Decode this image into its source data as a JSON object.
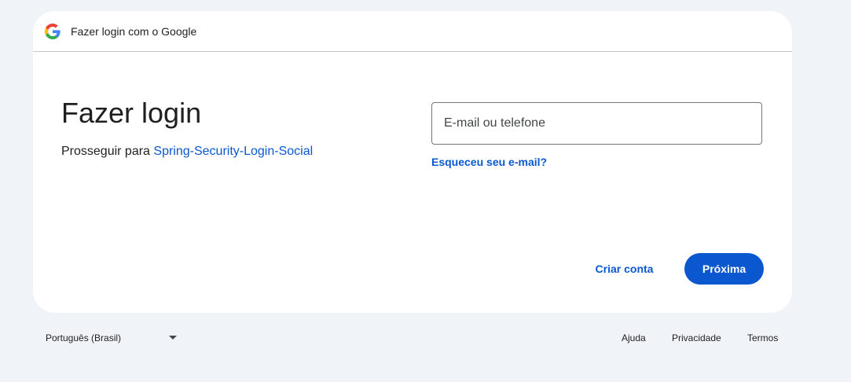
{
  "header": {
    "logo_icon": "google-g-logo",
    "text": "Fazer login com o Google"
  },
  "main": {
    "title": "Fazer login",
    "subtitle_prefix": "Prosseguir para ",
    "app_name": "Spring-Security-Login-Social",
    "email_input": {
      "placeholder": "E-mail ou telefone",
      "value": ""
    },
    "forgot_email_link": "Esqueceu seu e-mail?",
    "create_account_button": "Criar conta",
    "next_button": "Próxima"
  },
  "footer": {
    "language": "Português (Brasil)",
    "language_icon": "caret-down-icon",
    "links": {
      "help": "Ajuda",
      "privacy": "Privacidade",
      "terms": "Termos"
    }
  },
  "colors": {
    "page_background": "#f0f4f9",
    "card_background": "#ffffff",
    "accent": "#0b57d0",
    "text": "#1f1f1f",
    "google_blue": "#4285f4",
    "google_red": "#ea4335",
    "google_yellow": "#fbbc05",
    "google_green": "#34a853"
  }
}
